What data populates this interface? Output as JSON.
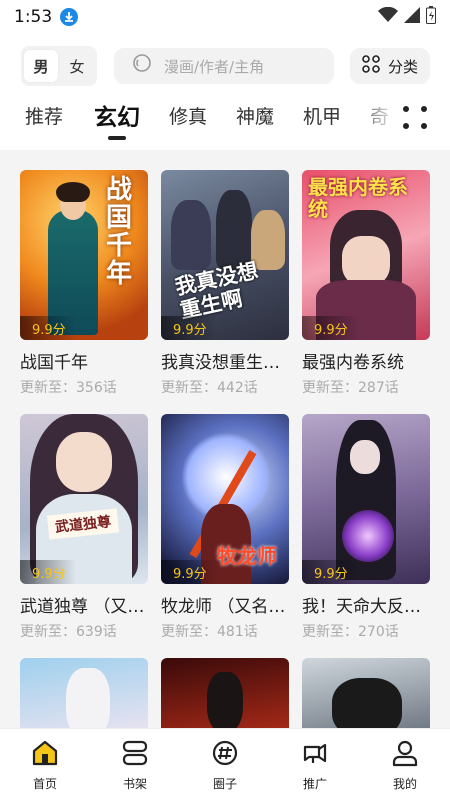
{
  "status_bar": {
    "time": "1:53"
  },
  "header": {
    "gender_options": [
      "男",
      "女"
    ],
    "search_placeholder": "漫画/作者/主角",
    "category_label": "分类"
  },
  "genre_tabs": [
    "推荐",
    "玄幻",
    "修真",
    "神魔",
    "机甲",
    "奇"
  ],
  "active_genre": "玄幻",
  "comics": [
    {
      "title": "战国千年",
      "update": "更新至：356话",
      "score": "9.9分",
      "cover_text": "战国千年"
    },
    {
      "title": "我真没想重生…",
      "update": "更新至：442话",
      "score": "9.9分",
      "cover_text": "我真没想重生啊"
    },
    {
      "title": "最强内卷系统",
      "update": "更新至：287话",
      "score": "9.9分",
      "cover_text": "最强内卷系统"
    },
    {
      "title": "武道独尊 （又…",
      "update": "更新至：639话",
      "score": "9.9分",
      "cover_text": "武道独尊"
    },
    {
      "title": "牧龙师 （又名…",
      "update": "更新至：481话",
      "score": "9.9分",
      "cover_text": "牧龙师"
    },
    {
      "title": "我！天命大反…",
      "update": "更新至：270话",
      "score": "9.9分",
      "cover_text": ""
    }
  ],
  "bottom_nav": [
    {
      "label": "首页",
      "icon": "home-icon"
    },
    {
      "label": "书架",
      "icon": "bookshelf-icon"
    },
    {
      "label": "圈子",
      "icon": "community-icon"
    },
    {
      "label": "推广",
      "icon": "promote-icon"
    },
    {
      "label": "我的",
      "icon": "profile-icon"
    }
  ],
  "colors": {
    "accent": "#1e88e5",
    "score": "#f5c518",
    "home_active": "#f5c518"
  }
}
